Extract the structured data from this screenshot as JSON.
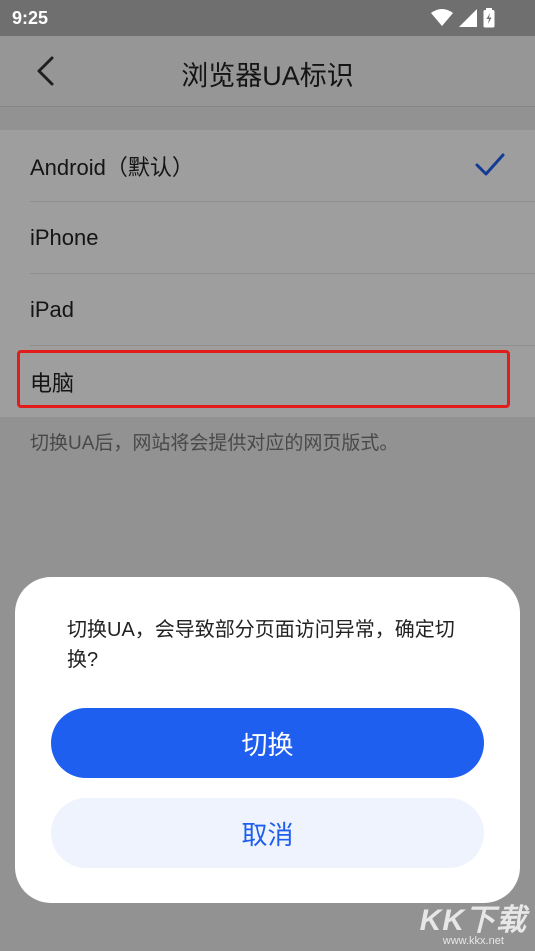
{
  "status_bar": {
    "time": "9:25",
    "icons": [
      "wifi-icon",
      "signal-icon",
      "battery-icon"
    ]
  },
  "app_bar": {
    "title": "浏览器UA标识",
    "back_icon": "chevron-left-icon"
  },
  "ua_options": [
    {
      "label": "Android（默认）",
      "selected": true
    },
    {
      "label": "iPhone",
      "selected": false
    },
    {
      "label": "iPad",
      "selected": false
    },
    {
      "label": "电脑",
      "selected": false
    }
  ],
  "hint": "切换UA后，网站将会提供对应的网页版式。",
  "dialog": {
    "message": "切换UA，会导致部分页面访问异常，确定切换?",
    "confirm_label": "切换",
    "cancel_label": "取消"
  },
  "watermark": {
    "brand": "KK下载",
    "url": "www.kkx.net"
  },
  "colors": {
    "accent": "#1f5ff0",
    "highlight": "#e41b1b"
  }
}
